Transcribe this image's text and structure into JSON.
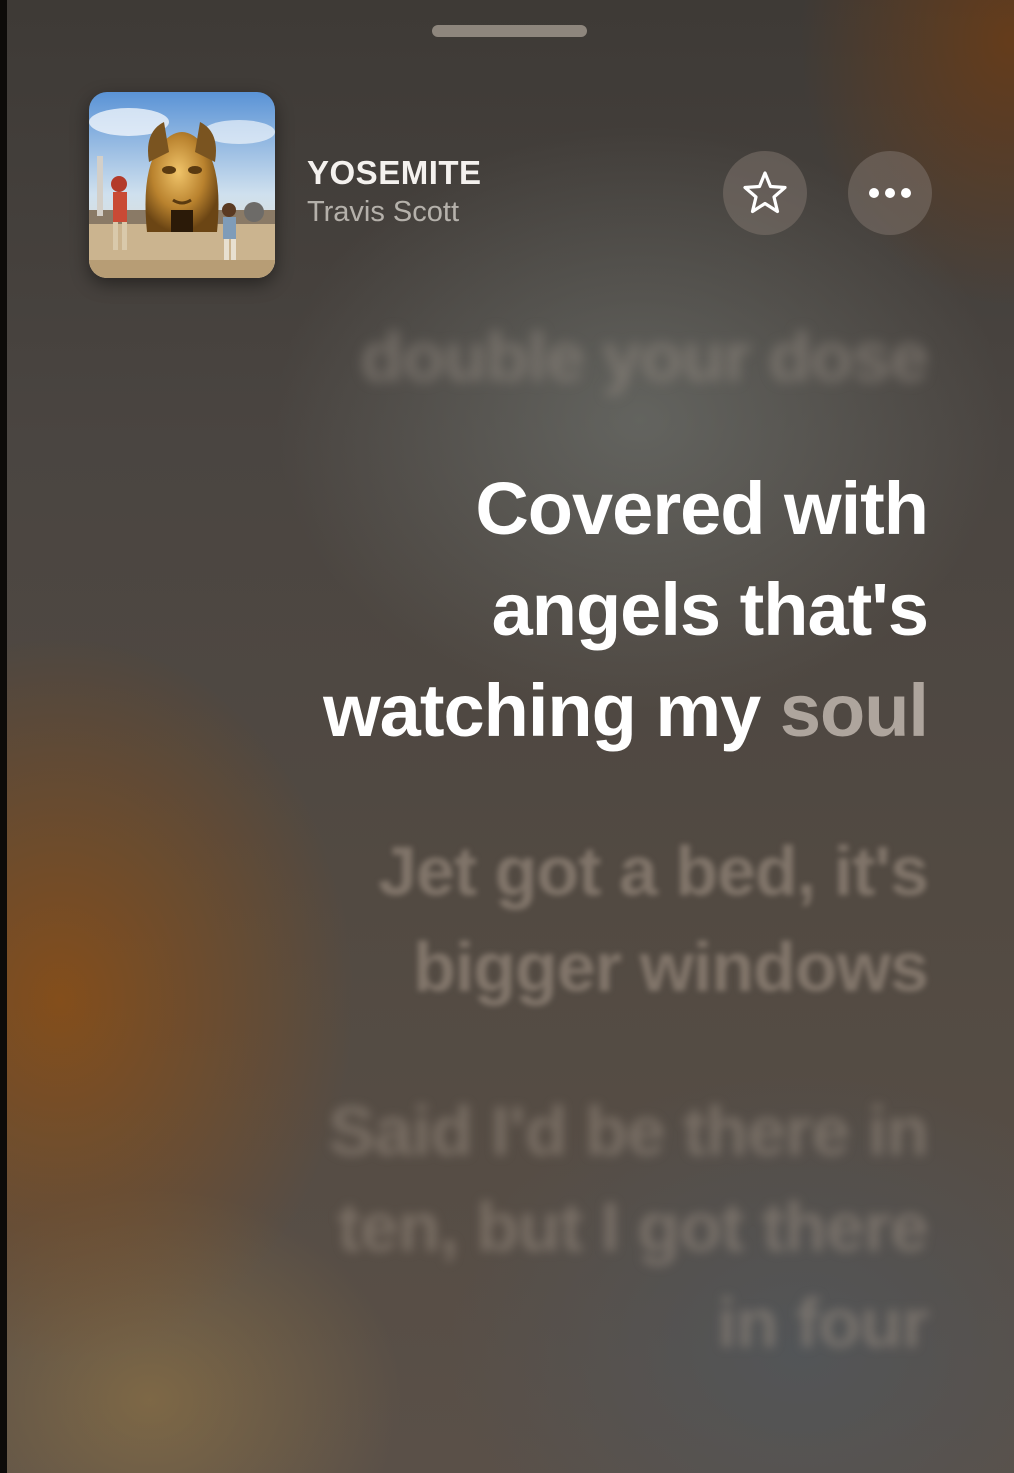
{
  "now_playing": {
    "title": "YOSEMITE",
    "artist": "Travis Scott",
    "artwork_icon": "album-artwork"
  },
  "actions": {
    "favorite_icon": "star-icon",
    "more_icon": "ellipsis-icon"
  },
  "lyrics": {
    "previous_line": "double your dose",
    "current_line": {
      "line1": "Covered with",
      "line2": "angels that's",
      "line3_sung": "watching my",
      "line3_upcoming": "soul"
    },
    "next_line_1": {
      "line1": "Jet got a bed, it's",
      "line2": "bigger windows"
    },
    "next_line_2": {
      "line1": "Said I'd be there in",
      "line2": "ten, but I got there",
      "line3": "in four"
    },
    "next_line_3": {
      "line1": ""
    }
  },
  "colors": {
    "active_lyric": "#ffffff",
    "upcoming_word": "#cdc4bc",
    "accent_orange": "#8c4e14"
  }
}
